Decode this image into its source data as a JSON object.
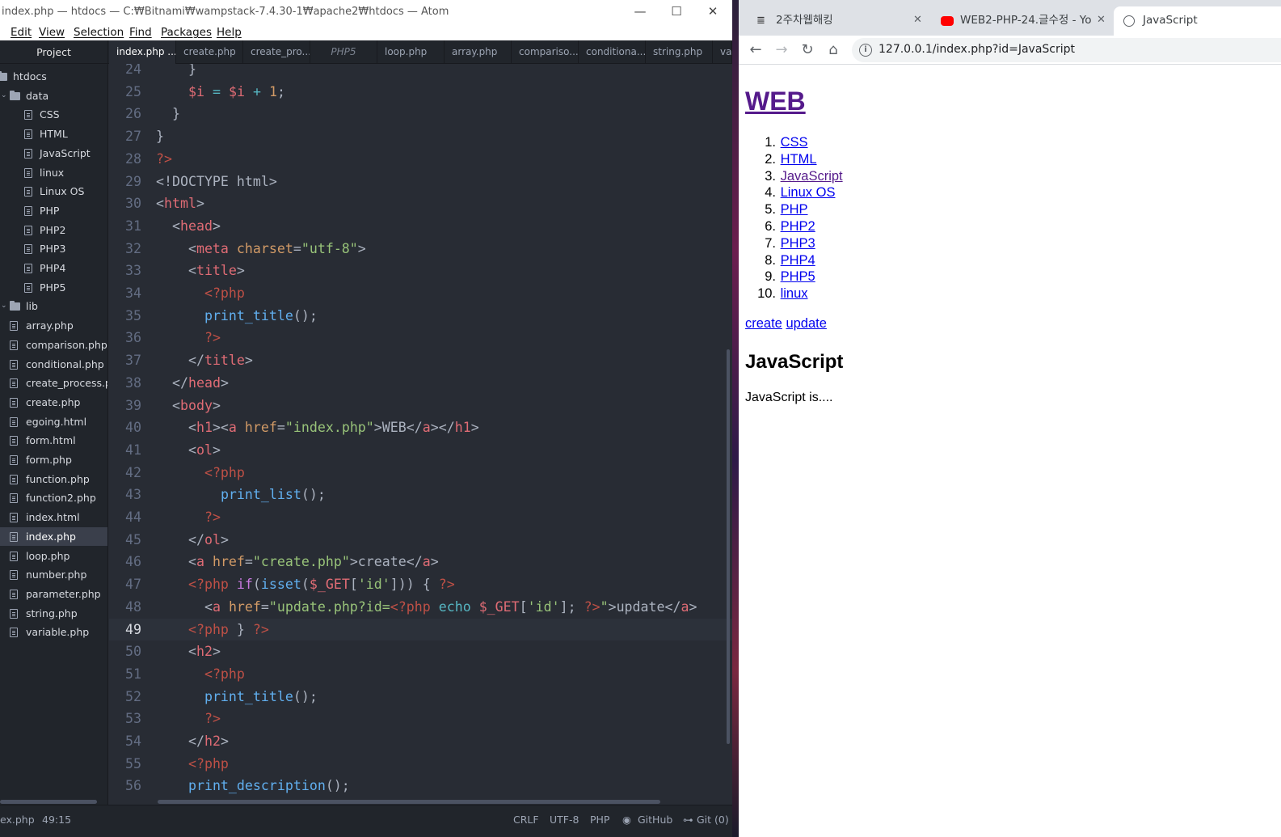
{
  "atom": {
    "title": "index.php — htdocs — C:₩Bitnami₩wampstack-7.4.30-1₩apache2₩htdocs — Atom",
    "menu": [
      "Edit",
      "View",
      "Selection",
      "Find",
      "Packages",
      "Help"
    ],
    "project_tab": "Project",
    "tabs": [
      {
        "label": "index.php ...",
        "active": true
      },
      {
        "label": "create.php"
      },
      {
        "label": "create_pro..."
      },
      {
        "label": "PHP5",
        "italic": true
      },
      {
        "label": "loop.php"
      },
      {
        "label": "array.php"
      },
      {
        "label": "compariso..."
      },
      {
        "label": "conditiona..."
      },
      {
        "label": "string.php"
      },
      {
        "label": "va"
      }
    ],
    "tree": [
      {
        "label": "htdocs",
        "type": "root"
      },
      {
        "label": "data",
        "type": "dir",
        "open": true
      },
      {
        "label": "CSS",
        "type": "file",
        "indent": 2
      },
      {
        "label": "HTML",
        "type": "file",
        "indent": 2
      },
      {
        "label": "JavaScript",
        "type": "file",
        "indent": 2
      },
      {
        "label": "linux",
        "type": "file",
        "indent": 2
      },
      {
        "label": "Linux OS",
        "type": "file",
        "indent": 2
      },
      {
        "label": "PHP",
        "type": "file",
        "indent": 2
      },
      {
        "label": "PHP2",
        "type": "file",
        "indent": 2
      },
      {
        "label": "PHP3",
        "type": "file",
        "indent": 2
      },
      {
        "label": "PHP4",
        "type": "file",
        "indent": 2
      },
      {
        "label": "PHP5",
        "type": "file",
        "indent": 2
      },
      {
        "label": "lib",
        "type": "dir",
        "open": true
      },
      {
        "label": "array.php",
        "type": "file",
        "indent": 1
      },
      {
        "label": "comparison.php",
        "type": "file",
        "indent": 1
      },
      {
        "label": "conditional.php",
        "type": "file",
        "indent": 1
      },
      {
        "label": "create_process.php",
        "type": "file",
        "indent": 1
      },
      {
        "label": "create.php",
        "type": "file",
        "indent": 1
      },
      {
        "label": "egoing.html",
        "type": "file",
        "indent": 1
      },
      {
        "label": "form.html",
        "type": "file",
        "indent": 1
      },
      {
        "label": "form.php",
        "type": "file",
        "indent": 1
      },
      {
        "label": "function.php",
        "type": "file",
        "indent": 1
      },
      {
        "label": "function2.php",
        "type": "file",
        "indent": 1
      },
      {
        "label": "index.html",
        "type": "file",
        "indent": 1
      },
      {
        "label": "index.php",
        "type": "file",
        "indent": 1,
        "selected": true
      },
      {
        "label": "loop.php",
        "type": "file",
        "indent": 1
      },
      {
        "label": "number.php",
        "type": "file",
        "indent": 1
      },
      {
        "label": "parameter.php",
        "type": "file",
        "indent": 1
      },
      {
        "label": "string.php",
        "type": "file",
        "indent": 1
      },
      {
        "label": "variable.php",
        "type": "file",
        "indent": 1
      }
    ],
    "current_line": 49,
    "code": [
      {
        "n": 24,
        "html": "    <span>}</span>"
      },
      {
        "n": 25,
        "html": "    <span class='v'>$i</span> <span class='o'>=</span> <span class='v'>$i</span> <span class='o'>+</span> <span class='n'>1</span>;"
      },
      {
        "n": 26,
        "html": "  }"
      },
      {
        "n": 27,
        "html": "}"
      },
      {
        "n": 28,
        "html": "<span class='pd'>?></span>"
      },
      {
        "n": 29,
        "html": "&lt;!DOCTYPE html&gt;"
      },
      {
        "n": 30,
        "html": "&lt;<span class='t'>html</span>&gt;"
      },
      {
        "n": 31,
        "html": "  &lt;<span class='t'>head</span>&gt;"
      },
      {
        "n": 32,
        "html": "    &lt;<span class='t'>meta</span> <span class='a'>charset</span>=<span class='s'>\"utf-8\"</span>&gt;"
      },
      {
        "n": 33,
        "html": "    &lt;<span class='t'>title</span>&gt;"
      },
      {
        "n": 34,
        "html": "      <span class='pd'>&lt;?php</span>"
      },
      {
        "n": 35,
        "html": "      <span class='f'>print_title</span>();"
      },
      {
        "n": 36,
        "html": "      <span class='pd'>?&gt;</span>"
      },
      {
        "n": 37,
        "html": "    &lt;/<span class='t'>title</span>&gt;"
      },
      {
        "n": 38,
        "html": "  &lt;/<span class='t'>head</span>&gt;"
      },
      {
        "n": 39,
        "html": "  &lt;<span class='t'>body</span>&gt;"
      },
      {
        "n": 40,
        "html": "    &lt;<span class='t'>h1</span>&gt;&lt;<span class='t'>a</span> <span class='a'>href</span>=<span class='s'>\"index.php\"</span>&gt;WEB&lt;/<span class='t'>a</span>&gt;&lt;/<span class='t'>h1</span>&gt;"
      },
      {
        "n": 41,
        "html": "    &lt;<span class='t'>ol</span>&gt;"
      },
      {
        "n": 42,
        "html": "      <span class='pd'>&lt;?php</span>"
      },
      {
        "n": 43,
        "html": "        <span class='f'>print_list</span>();"
      },
      {
        "n": 44,
        "html": "      <span class='pd'>?&gt;</span>"
      },
      {
        "n": 45,
        "html": "    &lt;/<span class='t'>ol</span>&gt;"
      },
      {
        "n": 46,
        "html": "    &lt;<span class='t'>a</span> <span class='a'>href</span>=<span class='s'>\"create.php\"</span>&gt;create&lt;/<span class='t'>a</span>&gt;"
      },
      {
        "n": 47,
        "html": "    <span class='pd'>&lt;?php</span> <span class='k'>if</span>(<span class='f'>isset</span>(<span class='v'>$_GET</span>[<span class='s'>'id'</span>])) { <span class='pd'>?&gt;</span>"
      },
      {
        "n": 48,
        "html": "      &lt;<span class='t'>a</span> <span class='a'>href</span>=<span class='s'>\"update.php?id=</span><span class='pd'>&lt;?php</span> <span class='o'>echo</span> <span class='v'>$_GET</span>[<span class='s'>'id'</span>]; <span class='pd'>?&gt;</span><span class='s'>\"</span>&gt;update&lt;/<span class='t'>a</span>&gt;"
      },
      {
        "n": 49,
        "html": "    <span class='pd'>&lt;?php</span> } <span class='pd'>?&gt;</span>"
      },
      {
        "n": 50,
        "html": "    &lt;<span class='t'>h2</span>&gt;"
      },
      {
        "n": 51,
        "html": "      <span class='pd'>&lt;?php</span>"
      },
      {
        "n": 52,
        "html": "      <span class='f'>print_title</span>();"
      },
      {
        "n": 53,
        "html": "      <span class='pd'>?&gt;</span>"
      },
      {
        "n": 54,
        "html": "    &lt;/<span class='t'>h2</span>&gt;"
      },
      {
        "n": 55,
        "html": "    <span class='pd'>&lt;?php</span>"
      },
      {
        "n": 56,
        "html": "    <span class='f'>print_description</span>();"
      }
    ],
    "status": {
      "file": "ex.php",
      "cursor": "49:15",
      "line_ending": "CRLF",
      "encoding": "UTF-8",
      "grammar": "PHP",
      "github": "GitHub",
      "git": "Git (0)"
    }
  },
  "browser": {
    "tabs": [
      {
        "title": "2주차웹해킹",
        "icon": "notion-icon"
      },
      {
        "title": "WEB2-PHP-24.글수정 - Yo",
        "icon": "youtube-icon"
      },
      {
        "title": "JavaScript",
        "icon": "globe-icon",
        "active": true
      }
    ],
    "url": "127.0.0.1/index.php?id=JavaScript",
    "page": {
      "h1": "WEB",
      "list": [
        {
          "num": "1.",
          "label": "CSS"
        },
        {
          "num": "2.",
          "label": "HTML"
        },
        {
          "num": "3.",
          "label": "JavaScript",
          "visited": true
        },
        {
          "num": "4.",
          "label": "Linux OS"
        },
        {
          "num": "5.",
          "label": "PHP"
        },
        {
          "num": "6.",
          "label": "PHP2"
        },
        {
          "num": "7.",
          "label": "PHP3"
        },
        {
          "num": "8.",
          "label": "PHP4"
        },
        {
          "num": "9.",
          "label": "PHP5"
        },
        {
          "num": "10.",
          "label": "linux"
        }
      ],
      "create_link": "create",
      "update_link": "update",
      "h2": "JavaScript",
      "description": "JavaScript is...."
    }
  }
}
